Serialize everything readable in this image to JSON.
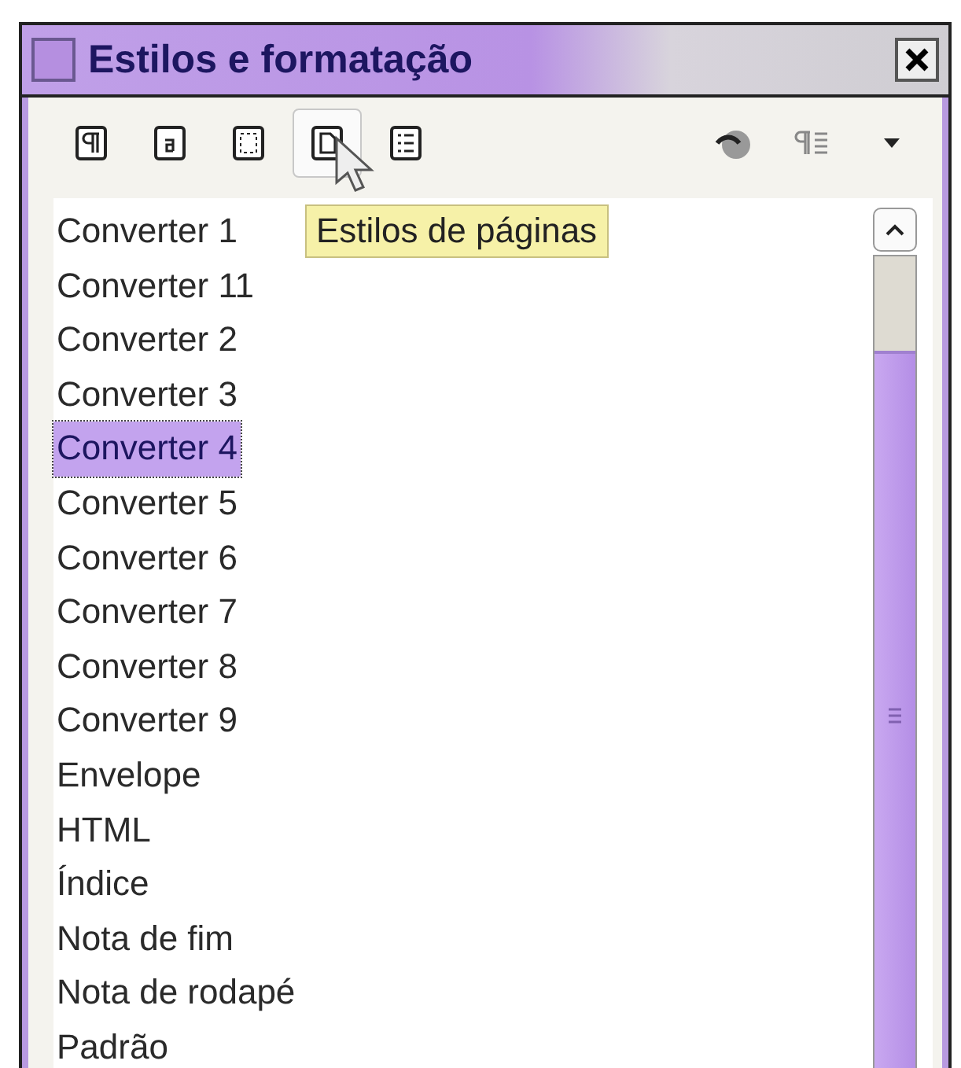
{
  "window": {
    "title": "Estilos e formatação"
  },
  "toolbar": {
    "families": [
      {
        "kind": "paragraph",
        "selected": false
      },
      {
        "kind": "character",
        "selected": false
      },
      {
        "kind": "frame",
        "selected": false
      },
      {
        "kind": "page",
        "selected": true
      },
      {
        "kind": "list",
        "selected": false
      }
    ]
  },
  "tooltip": "Estilos de páginas",
  "styles": [
    {
      "label": "Converter 1",
      "selected": false
    },
    {
      "label": "Converter 11",
      "selected": false
    },
    {
      "label": "Converter 2",
      "selected": false
    },
    {
      "label": "Converter 3",
      "selected": false
    },
    {
      "label": "Converter 4",
      "selected": true
    },
    {
      "label": "Converter 5",
      "selected": false
    },
    {
      "label": "Converter 6",
      "selected": false
    },
    {
      "label": "Converter 7",
      "selected": false
    },
    {
      "label": "Converter 8",
      "selected": false
    },
    {
      "label": "Converter 9",
      "selected": false
    },
    {
      "label": "Envelope",
      "selected": false
    },
    {
      "label": "HTML",
      "selected": false
    },
    {
      "label": "Índice",
      "selected": false
    },
    {
      "label": "Nota de fim",
      "selected": false
    },
    {
      "label": "Nota de rodapé",
      "selected": false
    },
    {
      "label": "Padrão",
      "selected": false
    }
  ]
}
